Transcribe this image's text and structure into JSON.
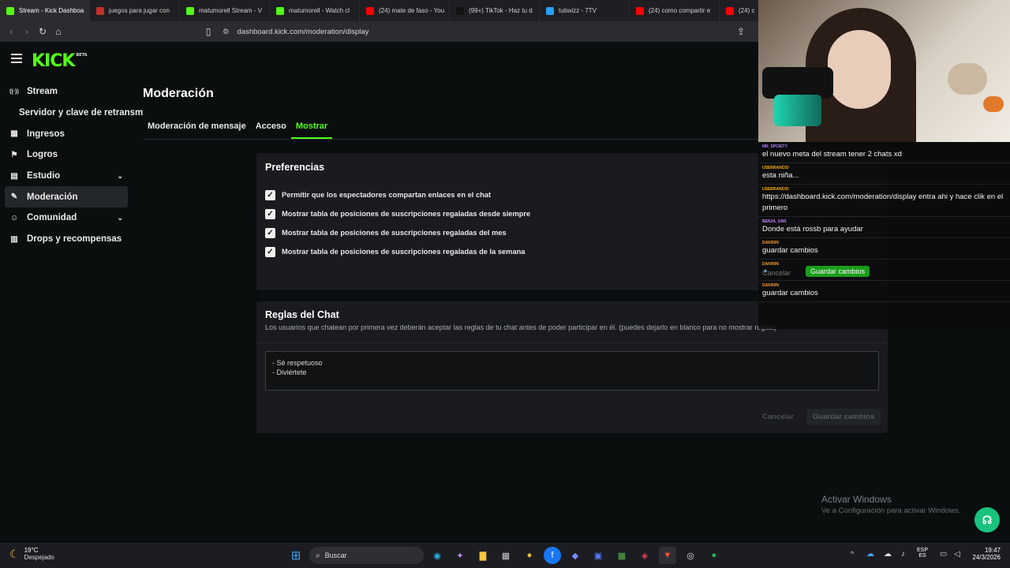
{
  "browser": {
    "tabs": [
      {
        "label": "Stream - Kick Dashboa",
        "color": "#53fc18",
        "active": true
      },
      {
        "label": "juegos para jugar con",
        "color": "#c4302b"
      },
      {
        "label": "matumorell Stream - V",
        "color": "#53fc18"
      },
      {
        "label": "matumorell - Watch cl",
        "color": "#53fc18"
      },
      {
        "label": "(24) mate de faso - You",
        "color": "#ff0000"
      },
      {
        "label": "(99+) TikTok - Haz tu d",
        "color": "#111111"
      },
      {
        "label": "tutiwizz - 7TV",
        "color": "#29a0ff"
      },
      {
        "label": "(24) como compartir e",
        "color": "#ff0000"
      },
      {
        "label": "(24) c",
        "color": "#ff0000"
      }
    ],
    "url": "dashboard.kick.com/moderation/display"
  },
  "logo": {
    "text": "KICK",
    "badge": "BETA"
  },
  "sidebar": {
    "items": [
      {
        "label": "Stream",
        "icon": "broadcast-icon"
      },
      {
        "label": "Servidor y clave de retransm",
        "icon": "",
        "sub": true
      },
      {
        "label": "Ingresos",
        "icon": "chart-icon"
      },
      {
        "label": "Logros",
        "icon": "flag-icon"
      },
      {
        "label": "Estudio",
        "icon": "layout-icon",
        "chevron": true
      },
      {
        "label": "Moderación",
        "icon": "wrench-icon",
        "active": true
      },
      {
        "label": "Comunidad",
        "icon": "people-icon",
        "chevron": true
      },
      {
        "label": "Drops y recompensas",
        "icon": "bars-icon"
      }
    ]
  },
  "main": {
    "title": "Moderación",
    "tabs": [
      {
        "label": "Moderación de mensaje"
      },
      {
        "label": "Acceso"
      },
      {
        "label": "Mostrar",
        "active": true
      }
    ],
    "preferences": {
      "title": "Preferencias",
      "options": [
        "Permitir que los espectadores compartan enlaces en el chat",
        "Mostrar tabla de posiciones de suscripciones regaladas desde siempre",
        "Mostrar tabla de posiciones de suscripciones regaladas del mes",
        "Mostrar tabla de posiciones de suscripciones regaladas de la semana"
      ]
    },
    "rules": {
      "title": "Reglas del Chat",
      "description": "Los usuarios que chatean por primera vez deberán aceptar las reglas de tu chat antes de poder participar en él. (puedes dejarlo en blanco para no mostrar reglas)",
      "line1": "- Sé respetuoso",
      "line2": "- Diviértete",
      "cancel": "Cancelar",
      "save": "Guardar cambios"
    }
  },
  "chat": {
    "messages": [
      {
        "user": "MR_SPCIETY",
        "color": "#b67cff",
        "text": "el nuevo meta del stream tener 2 chats xd"
      },
      {
        "user": "USERRANCIO",
        "color": "#ffb000",
        "text": "esta niña..."
      },
      {
        "user": "USERRANCIO",
        "color": "#ffb000",
        "text": "https://dashboard.kick.com/moderation/display entra ahi y hace clik en el primero"
      },
      {
        "user": "BENJA_GNS",
        "color": "#c987ff",
        "text": "Donde está rossb para ayudar"
      },
      {
        "user": "DAKR0N",
        "color": "#ff9d2e",
        "text": "guardar cambios"
      },
      {
        "user": "DAKR0N",
        "color": "#ff9d2e",
        "text": ""
      },
      {
        "user": "DAKR0N",
        "color": "#ff9d2e",
        "text": "guardar cambios"
      }
    ],
    "overlay_cancel": "Cancelar",
    "overlay_save": "Guardar cambios"
  },
  "watermark": {
    "line1": "Activar Windows",
    "line2": "Ve a Configuración para activar Windows."
  },
  "taskbar": {
    "weather_temp": "19°C",
    "weather_desc": "Despejado",
    "search": "Buscar",
    "lang1": "ESP",
    "lang2": "ES",
    "time": "19:47",
    "date": "24/3/2026"
  }
}
